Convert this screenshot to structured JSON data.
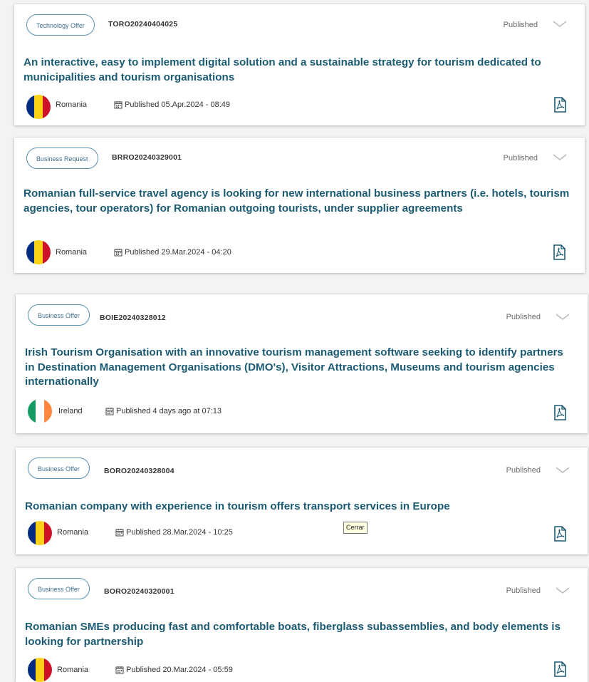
{
  "results": [
    {
      "type_label": "Technology Offer",
      "reference": "TORO20240404025",
      "status": "Published",
      "title": "An interactive, easy to implement digital solution and a sustainable strategy for tourism dedicated to municipalities and tourism organisations",
      "country": "Romania",
      "published": "Published 05.Apr.2024 - 08:49"
    },
    {
      "type_label": "Business Request",
      "reference": "BRRO20240329001",
      "status": "Published",
      "title": "Romanian full-service travel agency is looking for new international business partners (i.e. hotels, tourism agencies, tour operators) for Romanian outgoing tourists, under supplier agreements",
      "country": "Romania",
      "published": "Published 29.Mar.2024 - 04:20"
    },
    {
      "type_label": "Business Offer",
      "reference": "BOIE20240328012",
      "status": "Published",
      "title": "Irish Tourism Organisation with an innovative tourism management software seeking to identify partners in Destination Management Organisations (DMO's), Visitor Attractions, Museums and tourism agencies internationally",
      "country": "Ireland",
      "published": "Published 4 days ago at 07:13"
    },
    {
      "type_label": "Business Offer",
      "reference": "BORO20240328004",
      "status": "Published",
      "title": "Romanian company with experience in tourism offers transport services in Europe",
      "country": "Romania",
      "published": "Published 28.Mar.2024 - 10:25"
    },
    {
      "type_label": "Business Offer",
      "reference": "BORO20240320001",
      "status": "Published",
      "title": "Romanian SMEs producing fast and comfortable boats, fiberglass subassemblies, and body elements is looking for partnership",
      "country": "Romania",
      "published": "Published 20.Mar.2024 - 05:59"
    }
  ],
  "tooltip": "Cerrar",
  "colors": {
    "title": "#1b5b73",
    "tag_border": "#5a8fb0",
    "romania_flag": [
      "#002b7f",
      "#fcd116",
      "#ce1126"
    ],
    "ireland_flag": [
      "#169b62",
      "#ffffff",
      "#ff883e"
    ]
  },
  "icons": {
    "calendar": "calendar-icon",
    "pdf": "pdf-icon",
    "expand": "chevron-down-icon"
  }
}
